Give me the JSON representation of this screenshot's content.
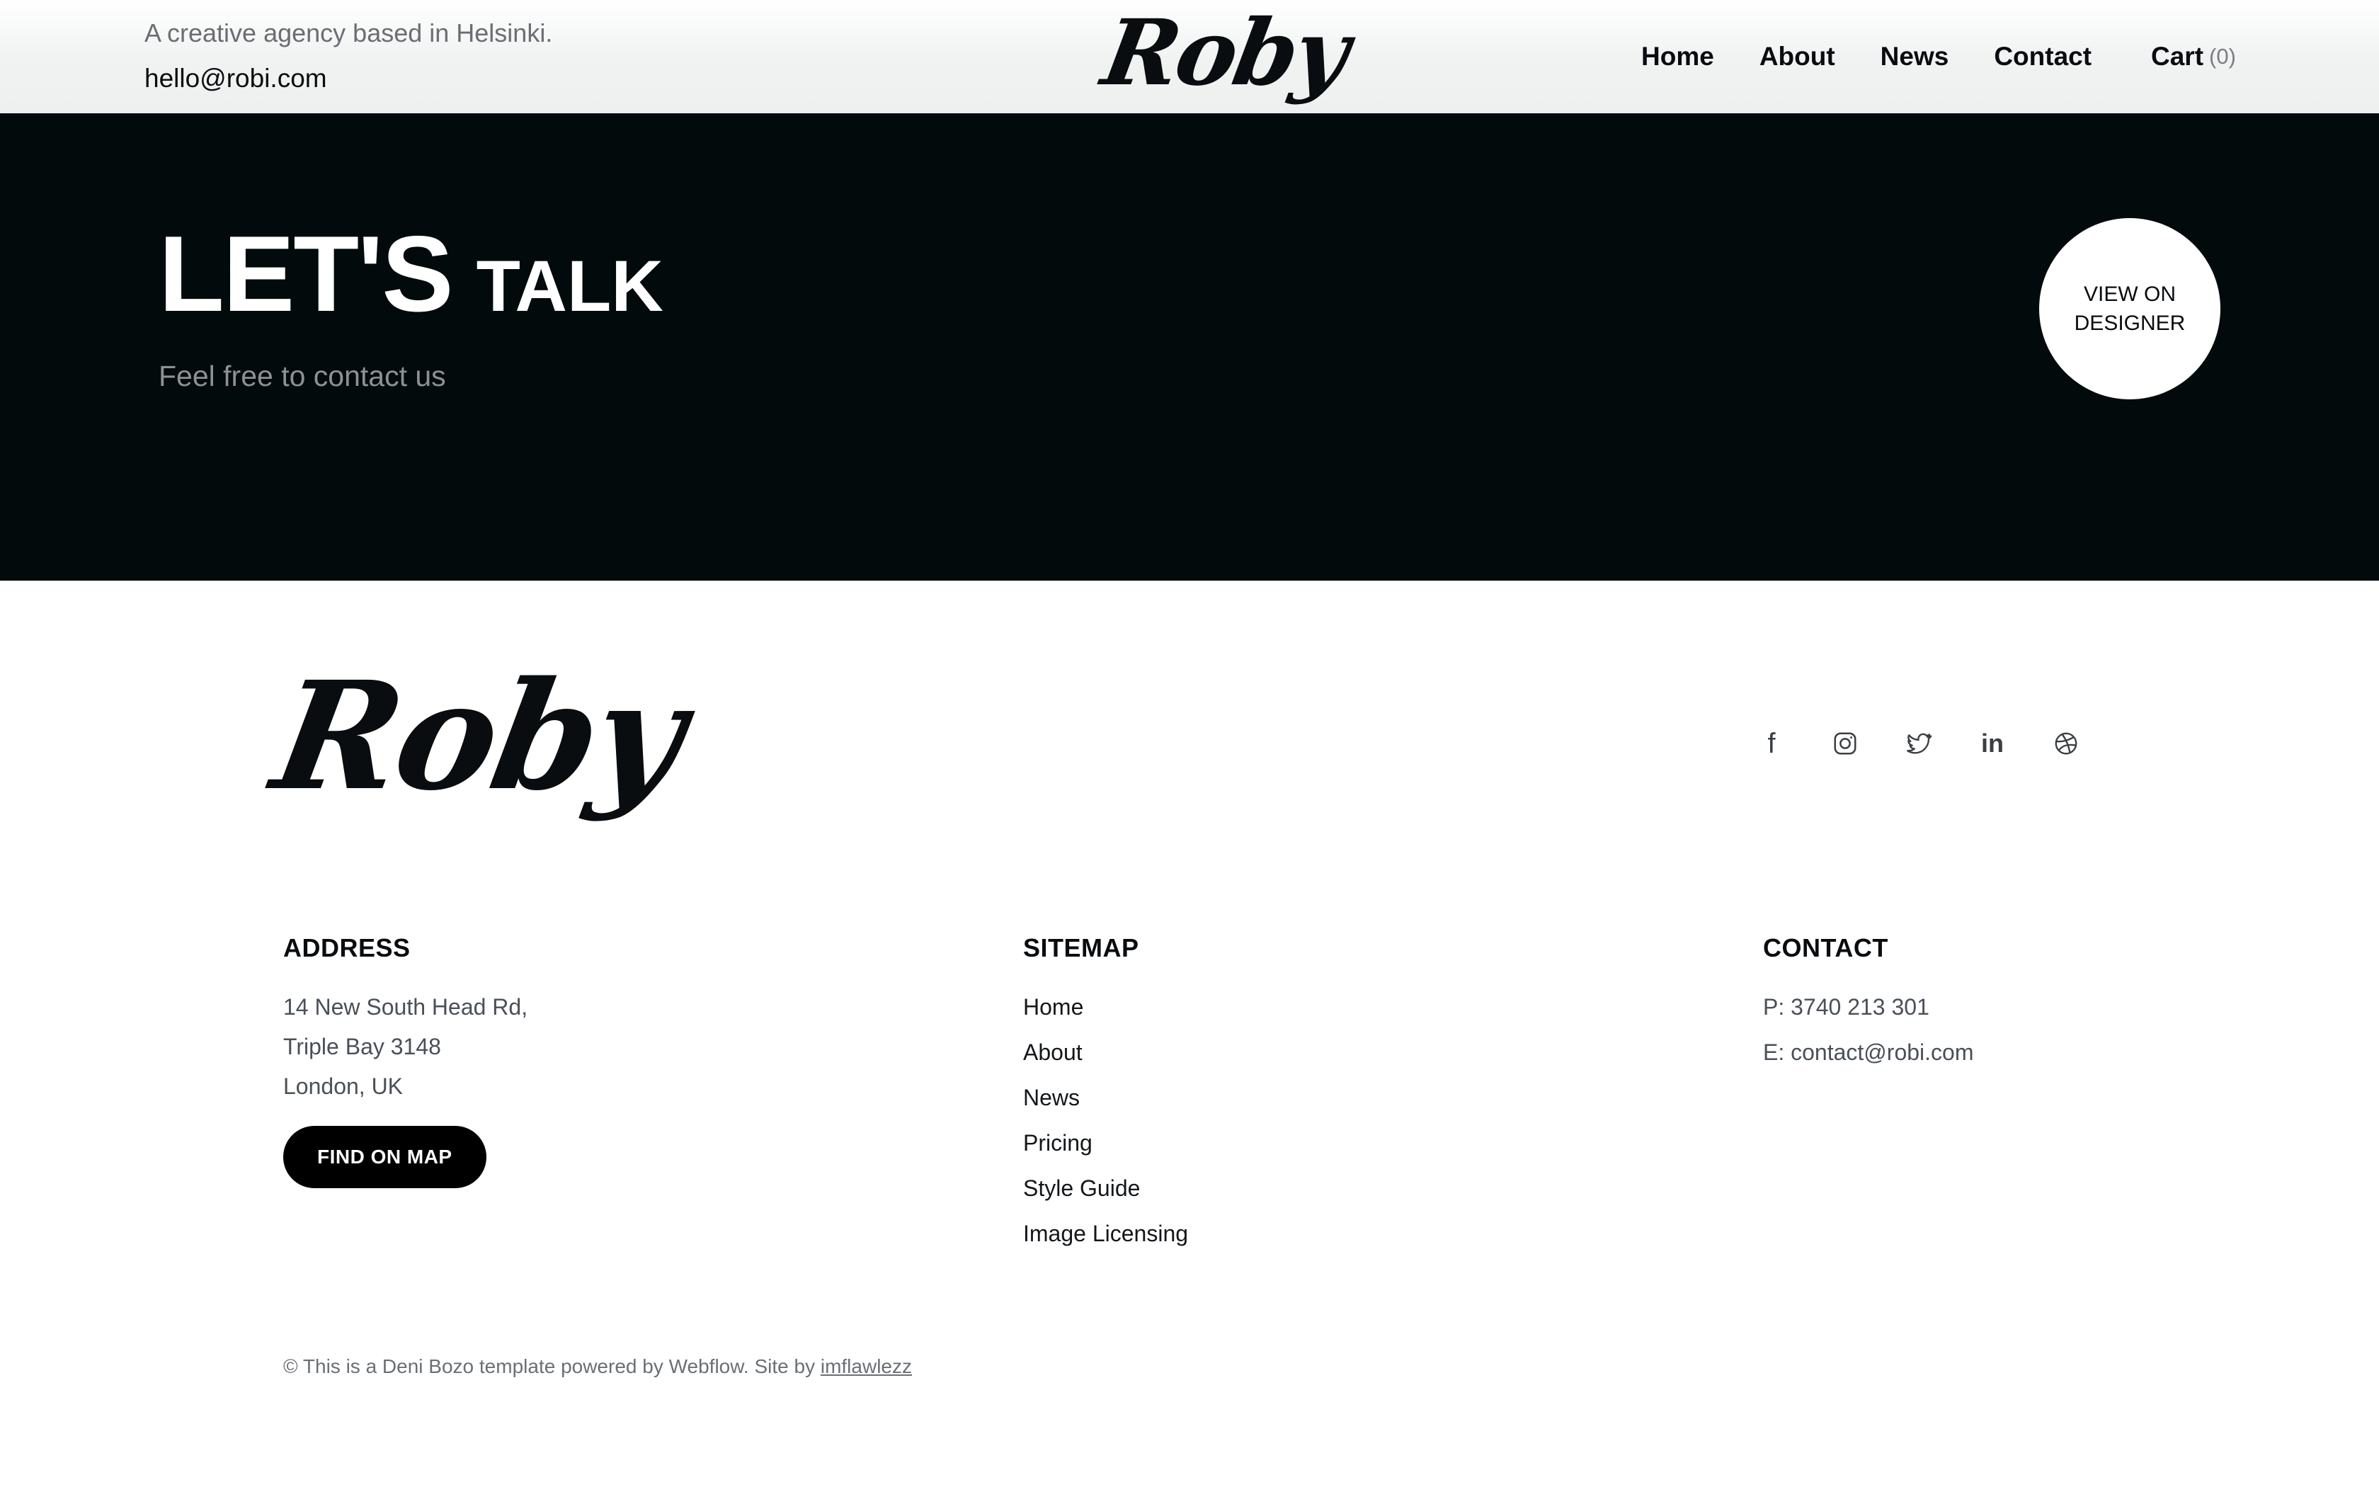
{
  "header": {
    "tagline": "A creative agency based in Helsinki.",
    "email": "hello@robi.com",
    "logo_text": "Roby",
    "nav": [
      "Home",
      "About",
      "News",
      "Contact"
    ],
    "cart_label": "Cart",
    "cart_count": "(0)"
  },
  "hero": {
    "title_bold": "LET'S",
    "title_light": "TALK",
    "subtitle": "Feel free to contact us",
    "designer_button": "VIEW ON DESIGNER",
    "background_color": "#030a0c"
  },
  "footer": {
    "logo_text": "Roby",
    "social_icons": [
      "facebook-icon",
      "instagram-icon",
      "twitter-icon",
      "linkedin-icon",
      "dribbble-icon"
    ],
    "address": {
      "heading": "ADDRESS",
      "lines": [
        "14 New South Head Rd,",
        "Triple Bay 3148",
        "London, UK"
      ],
      "button": "FIND ON MAP"
    },
    "sitemap": {
      "heading": "SITEMAP",
      "links": [
        "Home",
        "About",
        "News",
        "Pricing",
        "Style Guide",
        "Image Licensing"
      ]
    },
    "contact": {
      "heading": "CONTACT",
      "phone": "P: 3740 213 301",
      "email": "E: contact@robi.com"
    },
    "copyright_text": "© This is a Deni Bozo template powered by Webflow. Site by",
    "copyright_link": "imflawlezz"
  }
}
